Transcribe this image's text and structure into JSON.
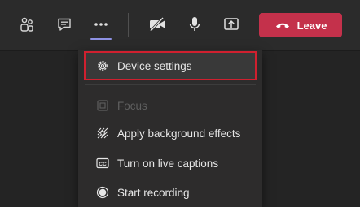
{
  "toolbar": {
    "icons": [
      "participants-icon",
      "chat-icon",
      "more-actions-icon",
      "camera-off-icon",
      "microphone-icon",
      "share-screen-icon"
    ],
    "leave_label": "Leave",
    "colors": {
      "leave": "#c4314b",
      "accent": "#8e92e4",
      "highlight_outline": "#d0202f"
    }
  },
  "menu": {
    "items": [
      {
        "label": "Device settings",
        "icon": "gear-icon",
        "state": "highlighted"
      },
      {
        "label": "Focus",
        "icon": "focus-icon",
        "state": "disabled"
      },
      {
        "label": "Apply background effects",
        "icon": "background-effects-icon",
        "state": "enabled"
      },
      {
        "label": "Turn on live captions",
        "icon": "captions-icon",
        "state": "enabled"
      },
      {
        "label": "Start recording",
        "icon": "record-icon",
        "state": "enabled"
      }
    ]
  }
}
